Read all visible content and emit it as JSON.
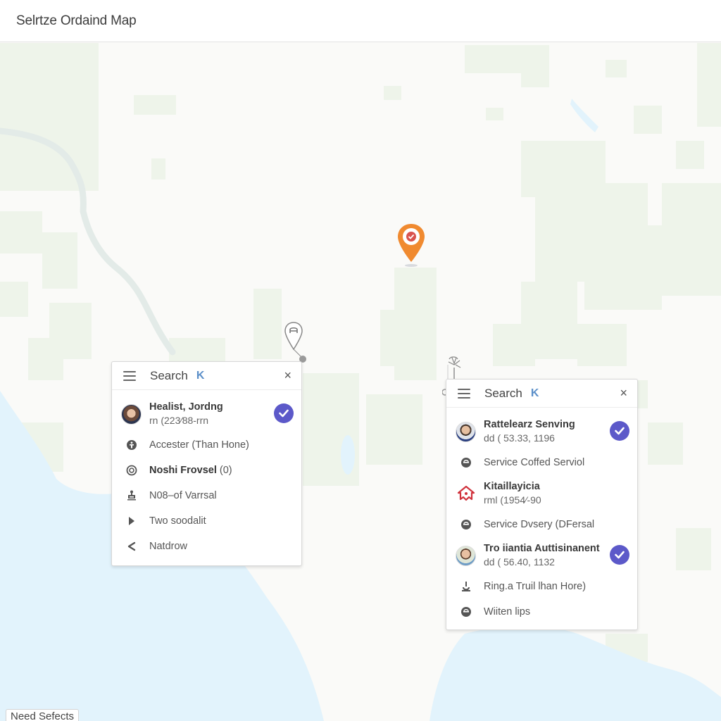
{
  "header": {
    "title": "Selrtze Ordaind Map"
  },
  "map": {
    "colors": {
      "land": "#fafaf8",
      "park": "#eef4ea",
      "water": "#e2f3fc",
      "river": "#e4ebe8"
    },
    "markers": [
      {
        "name": "orange-location-pin",
        "icon": "check-badge",
        "color": "#f08a30"
      },
      {
        "name": "outline-location-pin",
        "icon": "car"
      },
      {
        "name": "tree-marker",
        "icon": "tree"
      }
    ]
  },
  "panels": [
    {
      "search_label": "Search",
      "search_key": "K",
      "close_label": "×",
      "items": [
        {
          "type": "person",
          "avatar": "woman",
          "name": "Healist, Jordng",
          "sub": "rn (223⁄88-rrn",
          "checked": true
        },
        {
          "type": "simple",
          "icon": "lock-icon",
          "label": "Accester (Than Hone)"
        },
        {
          "type": "simple",
          "icon": "target-icon",
          "label_bold": "Noshi Frovsel",
          "label": " (0)"
        },
        {
          "type": "simple",
          "icon": "stamp-icon",
          "label": "N08–of Varrsal"
        },
        {
          "type": "simple",
          "icon": "play-icon",
          "label": "Two soodalit"
        },
        {
          "type": "simple",
          "icon": "chevron-left-icon",
          "label": "Natdrow"
        }
      ]
    },
    {
      "search_label": "Search",
      "search_key": "K",
      "close_label": "×",
      "items": [
        {
          "type": "person",
          "avatar": "man1",
          "name": "Rattelearz Senving",
          "sub": "dd ( 53.33, 1196",
          "checked": true
        },
        {
          "type": "simple",
          "icon": "lock-icon",
          "label": "Service Coffed Serviol"
        },
        {
          "type": "person",
          "avatar": "house",
          "name": "Kitaillayicia",
          "sub": "rml (1954⁄-90",
          "checked": false
        },
        {
          "type": "simple",
          "icon": "lock-icon",
          "label": "Service Dvsery (DFersal"
        },
        {
          "type": "person",
          "avatar": "man2",
          "name": "Tro iiantia Auttisinanent",
          "sub": "dd ( 56.40, 1132",
          "checked": true
        },
        {
          "type": "simple",
          "icon": "joystick-icon",
          "label": "Ring.a Truil lhan Hore)"
        },
        {
          "type": "simple",
          "icon": "lock-icon",
          "label": "Wiiten lips"
        }
      ]
    }
  ],
  "footer_badge": "Need Sefects"
}
